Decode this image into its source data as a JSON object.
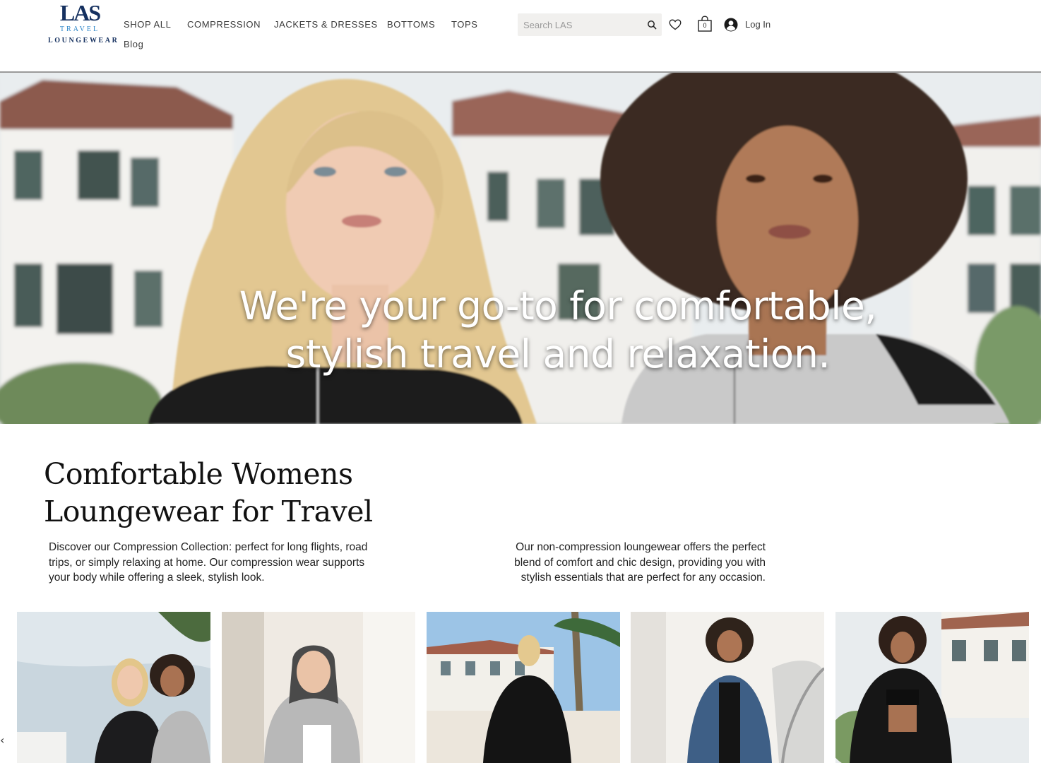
{
  "brand": {
    "logo_mark": "LAS",
    "logo_line1": "TRAVEL",
    "logo_line2": "LOUNGEWEAR"
  },
  "nav": {
    "items": [
      {
        "label": "SHOP ALL"
      },
      {
        "label": "COMPRESSION"
      },
      {
        "label": "JACKETS & DRESSES"
      },
      {
        "label": "BOTTOMS"
      },
      {
        "label": "TOPS"
      },
      {
        "label": "Blog"
      }
    ]
  },
  "header": {
    "search_placeholder": "Search LAS",
    "cart_count": "0",
    "login_label": "Log In"
  },
  "hero": {
    "line1": "We're your go-to for comfortable,",
    "line2": "stylish travel and relaxation."
  },
  "intro": {
    "headline_line1": "Comfortable Womens",
    "headline_line2": "Loungewear for Travel",
    "left_text": "Discover our Compression Collection: perfect for long flights, road trips, or simply relaxing at home. Our compression wear supports your body while offering a sleek, stylish look.",
    "right_text": "Our non-compression loungewear offers the perfect blend of comfort and chic design, providing you with stylish essentials that are perfect for any occasion."
  },
  "colors": {
    "brand_navy": "#15305f",
    "brand_blue": "#2a84c8",
    "search_bg": "#f1f0ee"
  },
  "icons": [
    "search-icon",
    "heart-icon",
    "cart-icon",
    "user-avatar-icon",
    "chevron-left-icon"
  ]
}
